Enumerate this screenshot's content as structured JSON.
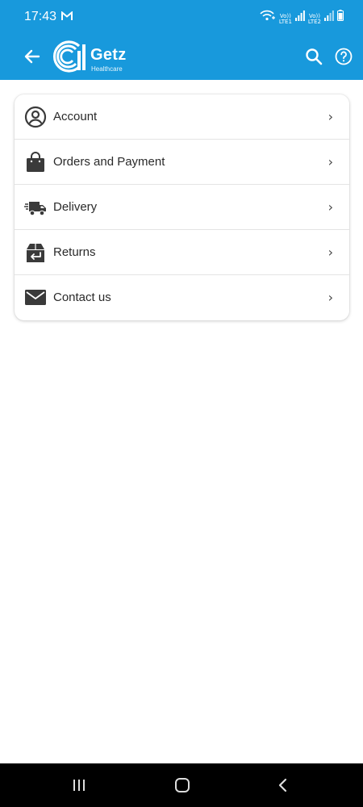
{
  "status_bar": {
    "time": "17:43",
    "sim1": [
      "Vo))",
      "LTE1"
    ],
    "sim2": [
      "Vo))",
      "LTE2"
    ]
  },
  "app_bar": {
    "logo_word": "Getz",
    "logo_sub": "Healthcare",
    "accent_color": "#1899dc"
  },
  "menu": {
    "items": [
      {
        "label": "Account",
        "icon": "account-circle-icon"
      },
      {
        "label": "Orders and Payment",
        "icon": "shopping-bag-icon"
      },
      {
        "label": "Delivery",
        "icon": "delivery-truck-icon"
      },
      {
        "label": "Returns",
        "icon": "return-box-icon"
      },
      {
        "label": "Contact us",
        "icon": "mail-icon"
      }
    ],
    "chevron": "›"
  }
}
